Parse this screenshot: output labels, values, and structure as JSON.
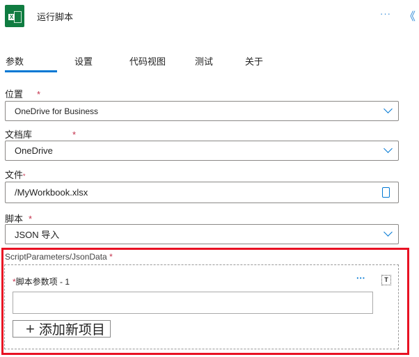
{
  "header": {
    "title": "运行脚本",
    "more": "···",
    "collapse": "《"
  },
  "tabs": [
    {
      "label": "参数"
    },
    {
      "label": "设置"
    },
    {
      "label": "代码视图"
    },
    {
      "label": "测试"
    },
    {
      "label": "关于"
    }
  ],
  "fields": {
    "location": {
      "label": "位置",
      "value": "OneDrive for Business"
    },
    "library": {
      "label": "文档库",
      "value": "OneDrive"
    },
    "file": {
      "label": "文件",
      "value": "/MyWorkbook.xlsx"
    },
    "script": {
      "label": "脚本",
      "value": "JSON 导入"
    }
  },
  "params": {
    "label": "ScriptParameters/JsonData",
    "item_label": "脚本参数项 - 1",
    "item_value": "",
    "more": "···",
    "add_label": "添加新项目",
    "add_icon": "+"
  },
  "required_mark": "*",
  "logo_letter": "X"
}
